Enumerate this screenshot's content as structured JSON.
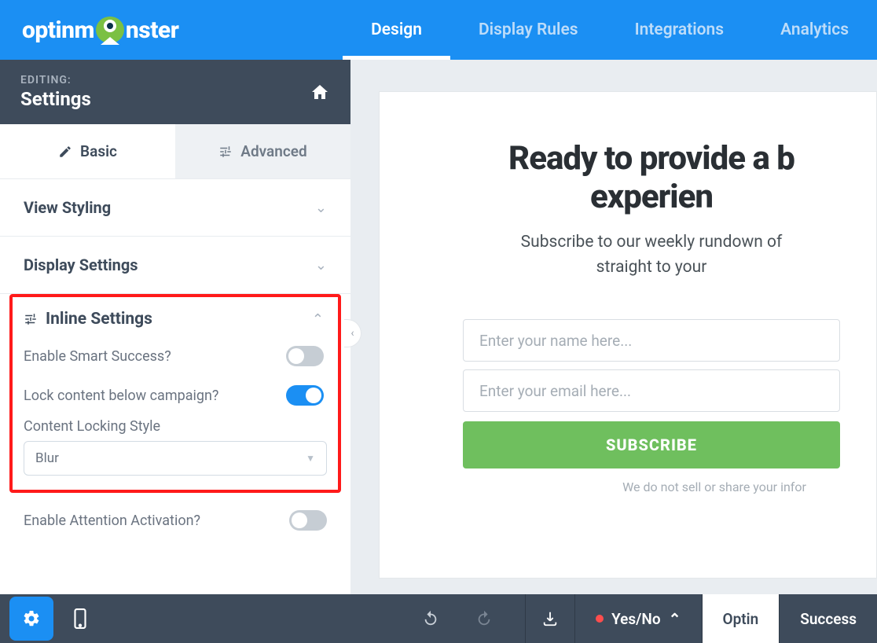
{
  "brand": {
    "name_left": "optinm",
    "name_right": "nster"
  },
  "topnav": [
    "Design",
    "Display Rules",
    "Integrations",
    "Analytics"
  ],
  "sidebar": {
    "editing_label": "EDITING:",
    "title": "Settings",
    "tabs": {
      "basic": "Basic",
      "advanced": "Advanced"
    },
    "panels": {
      "view_styling": "View Styling",
      "display_settings": "Display Settings",
      "inline_settings": "Inline Settings"
    },
    "inline": {
      "smart_success": "Enable Smart Success?",
      "lock_content": "Lock content below campaign?",
      "locking_style_label": "Content Locking Style",
      "locking_style_value": "Blur",
      "attention_activation": "Enable Attention Activation?"
    }
  },
  "preview": {
    "headline_l1": "Ready to provide a b",
    "headline_l2": "experien",
    "sub_l1": "Subscribe to our weekly rundown of",
    "sub_l2": "straight to your",
    "name_placeholder": "Enter your name here...",
    "email_placeholder": "Enter your email here...",
    "subscribe": "SUBSCRIBE",
    "privacy": "We do not sell or share your infor"
  },
  "bottombar": {
    "yesno": "Yes/No",
    "optin": "Optin",
    "success": "Success"
  }
}
